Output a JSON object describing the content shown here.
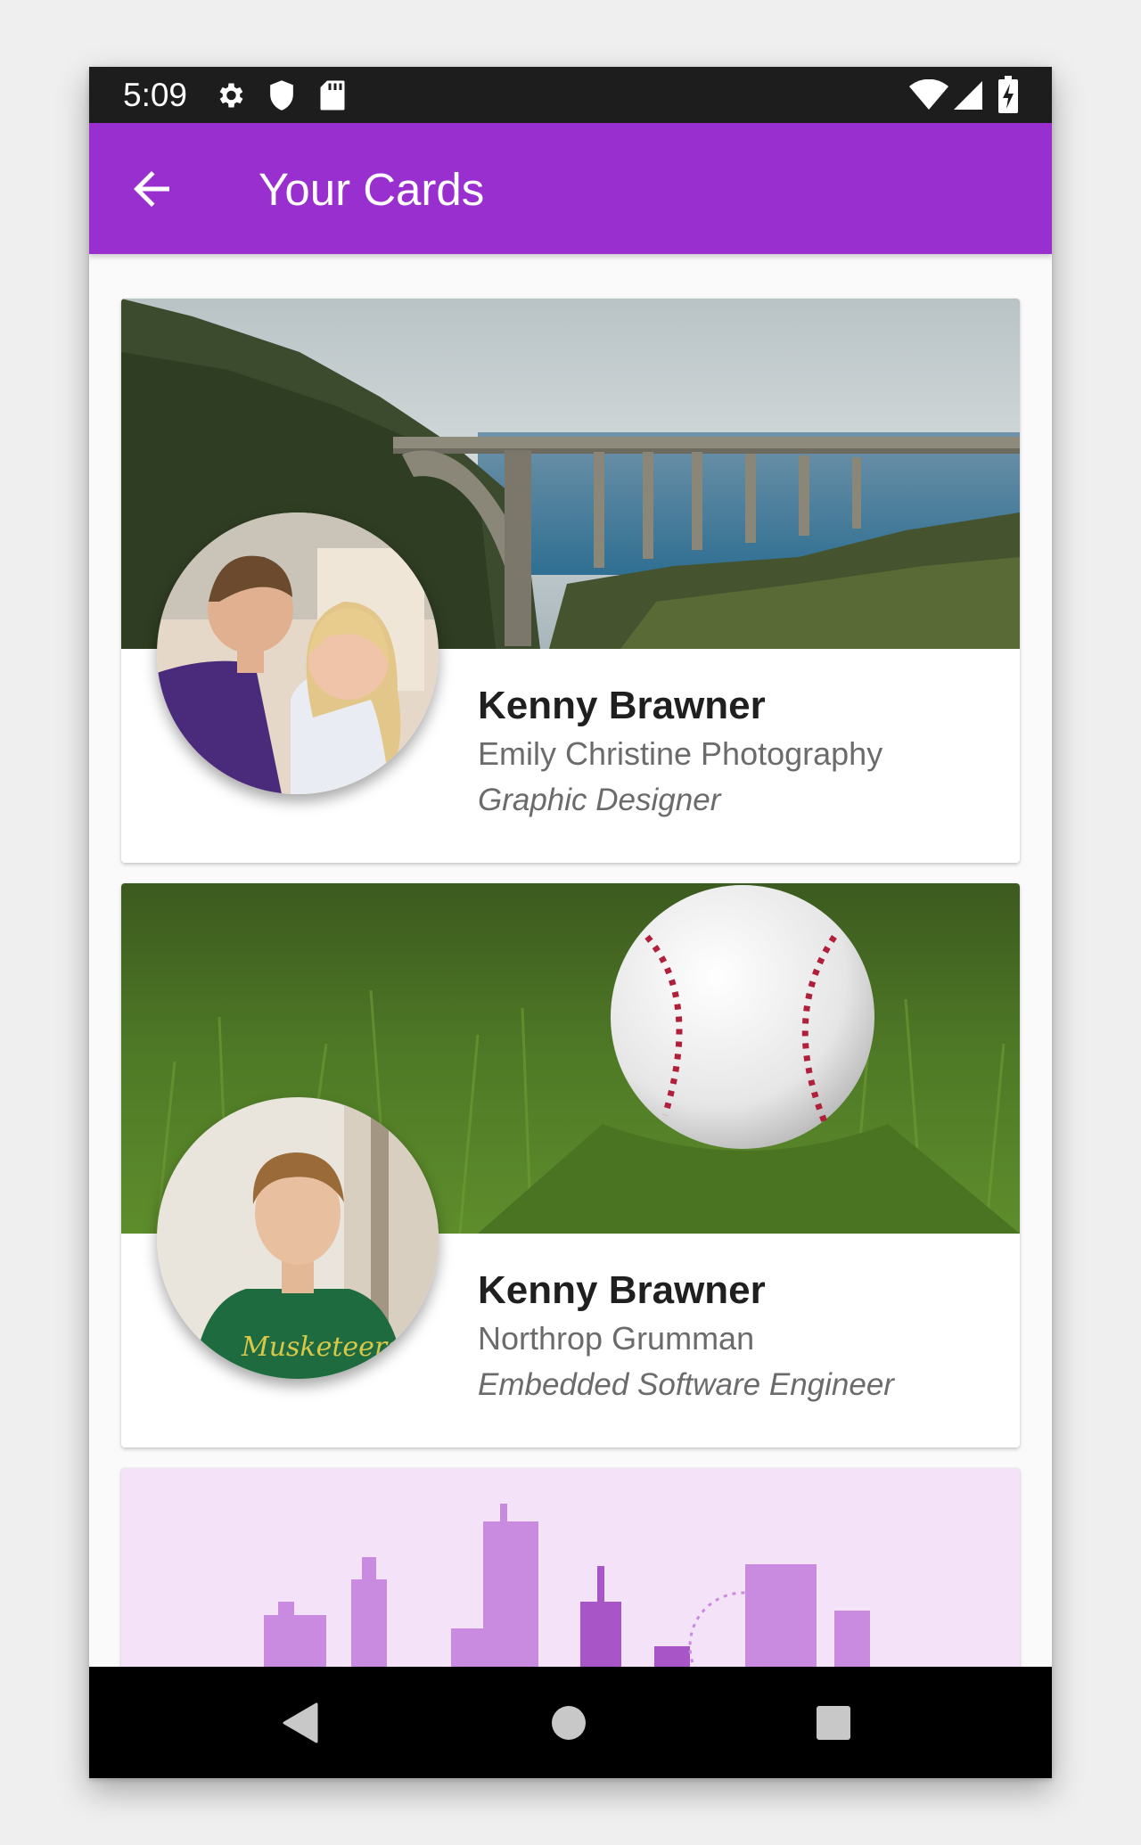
{
  "status_bar": {
    "time": "5:09",
    "left_icons": [
      "gear-icon",
      "shield-icon",
      "sd-card-icon"
    ],
    "right_icons": [
      "wifi-icon",
      "signal-icon",
      "battery-charging-icon"
    ]
  },
  "toolbar": {
    "back_icon": "arrow-left-icon",
    "title": "Your Cards",
    "color": "#9a2fcf"
  },
  "cards": [
    {
      "name": "Kenny Brawner",
      "company": "Emily Christine Photography",
      "title": "Graphic Designer",
      "banner": "coastal-bridge-photo",
      "avatar": "couple-portrait-photo"
    },
    {
      "name": "Kenny Brawner",
      "company": "Northrop Grumman",
      "title": "Embedded Software Engineer",
      "banner": "baseball-on-grass-photo",
      "avatar": "man-green-shirt-portrait-photo",
      "avatar_shirt_text": "Musketeers"
    },
    {
      "banner": "purple-city-skyline-illustration"
    }
  ],
  "navigation_bar": {
    "buttons": [
      "back-triangle-icon",
      "home-circle-icon",
      "recents-square-icon"
    ]
  }
}
